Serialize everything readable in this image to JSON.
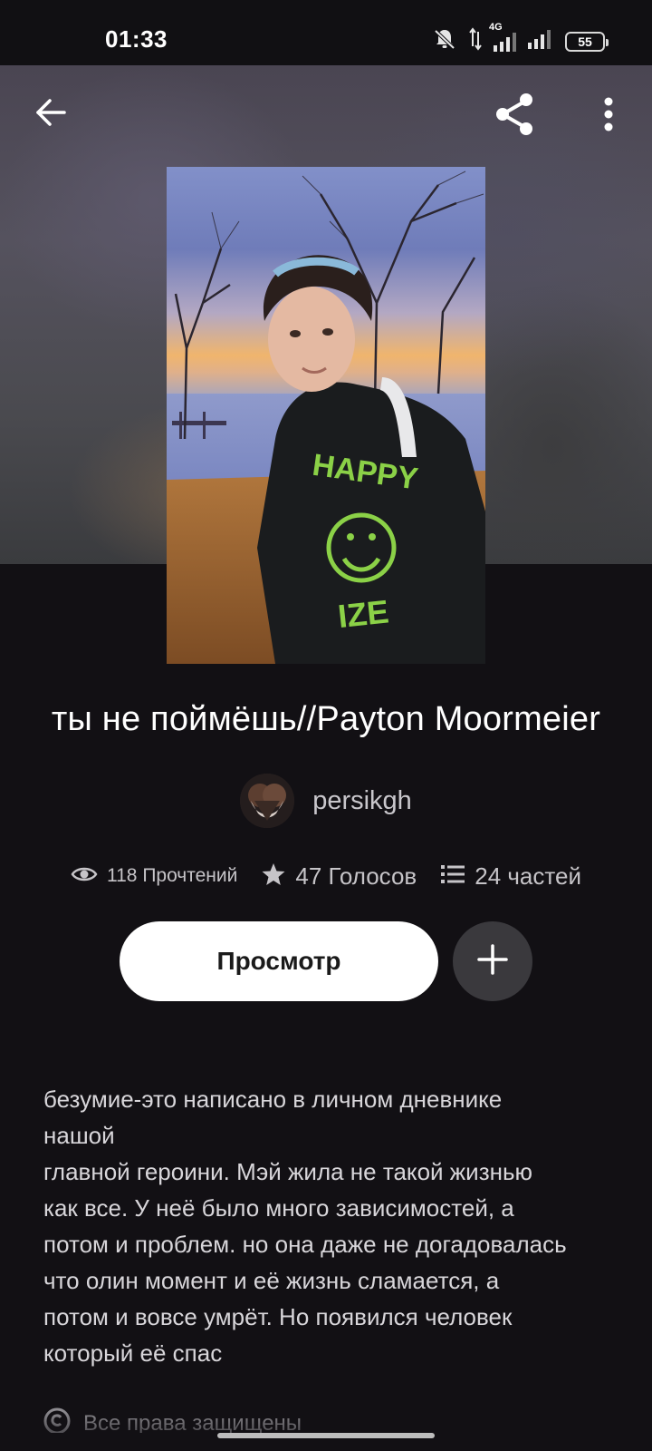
{
  "status_bar": {
    "time": "01:33",
    "network_label": "4G",
    "battery_level": "55"
  },
  "header": {
    "back_icon": "arrow-left-icon",
    "share_icon": "share-icon",
    "more_icon": "more-vertical-icon"
  },
  "story": {
    "title": "ты не поймёшь//Payton Moormeier",
    "author": "persikgh",
    "stats": {
      "reads": "118 Прочтений",
      "votes": "47 Голосов",
      "parts": "24 частей"
    },
    "read_button_label": "Просмотр",
    "add_icon": "plus-icon",
    "description_lines": [
      "безумие-это написано в личном дневнике",
      "нашой",
      "главной героини. Мэй жила не такой жизнью",
      "как все. У неё было много зависимостей, а",
      "потом и проблем. но она даже не догадовалась",
      "что олин момент и её жизнь сламается, а",
      "потом и вовсе умрёт. Но появился человек",
      "который её спас"
    ],
    "copyright": "Все права защищены"
  },
  "colors": {
    "background": "#121014",
    "button_primary": "#ffffff",
    "button_secondary": "#3a393d",
    "muted_text": "#c6c4c8"
  }
}
